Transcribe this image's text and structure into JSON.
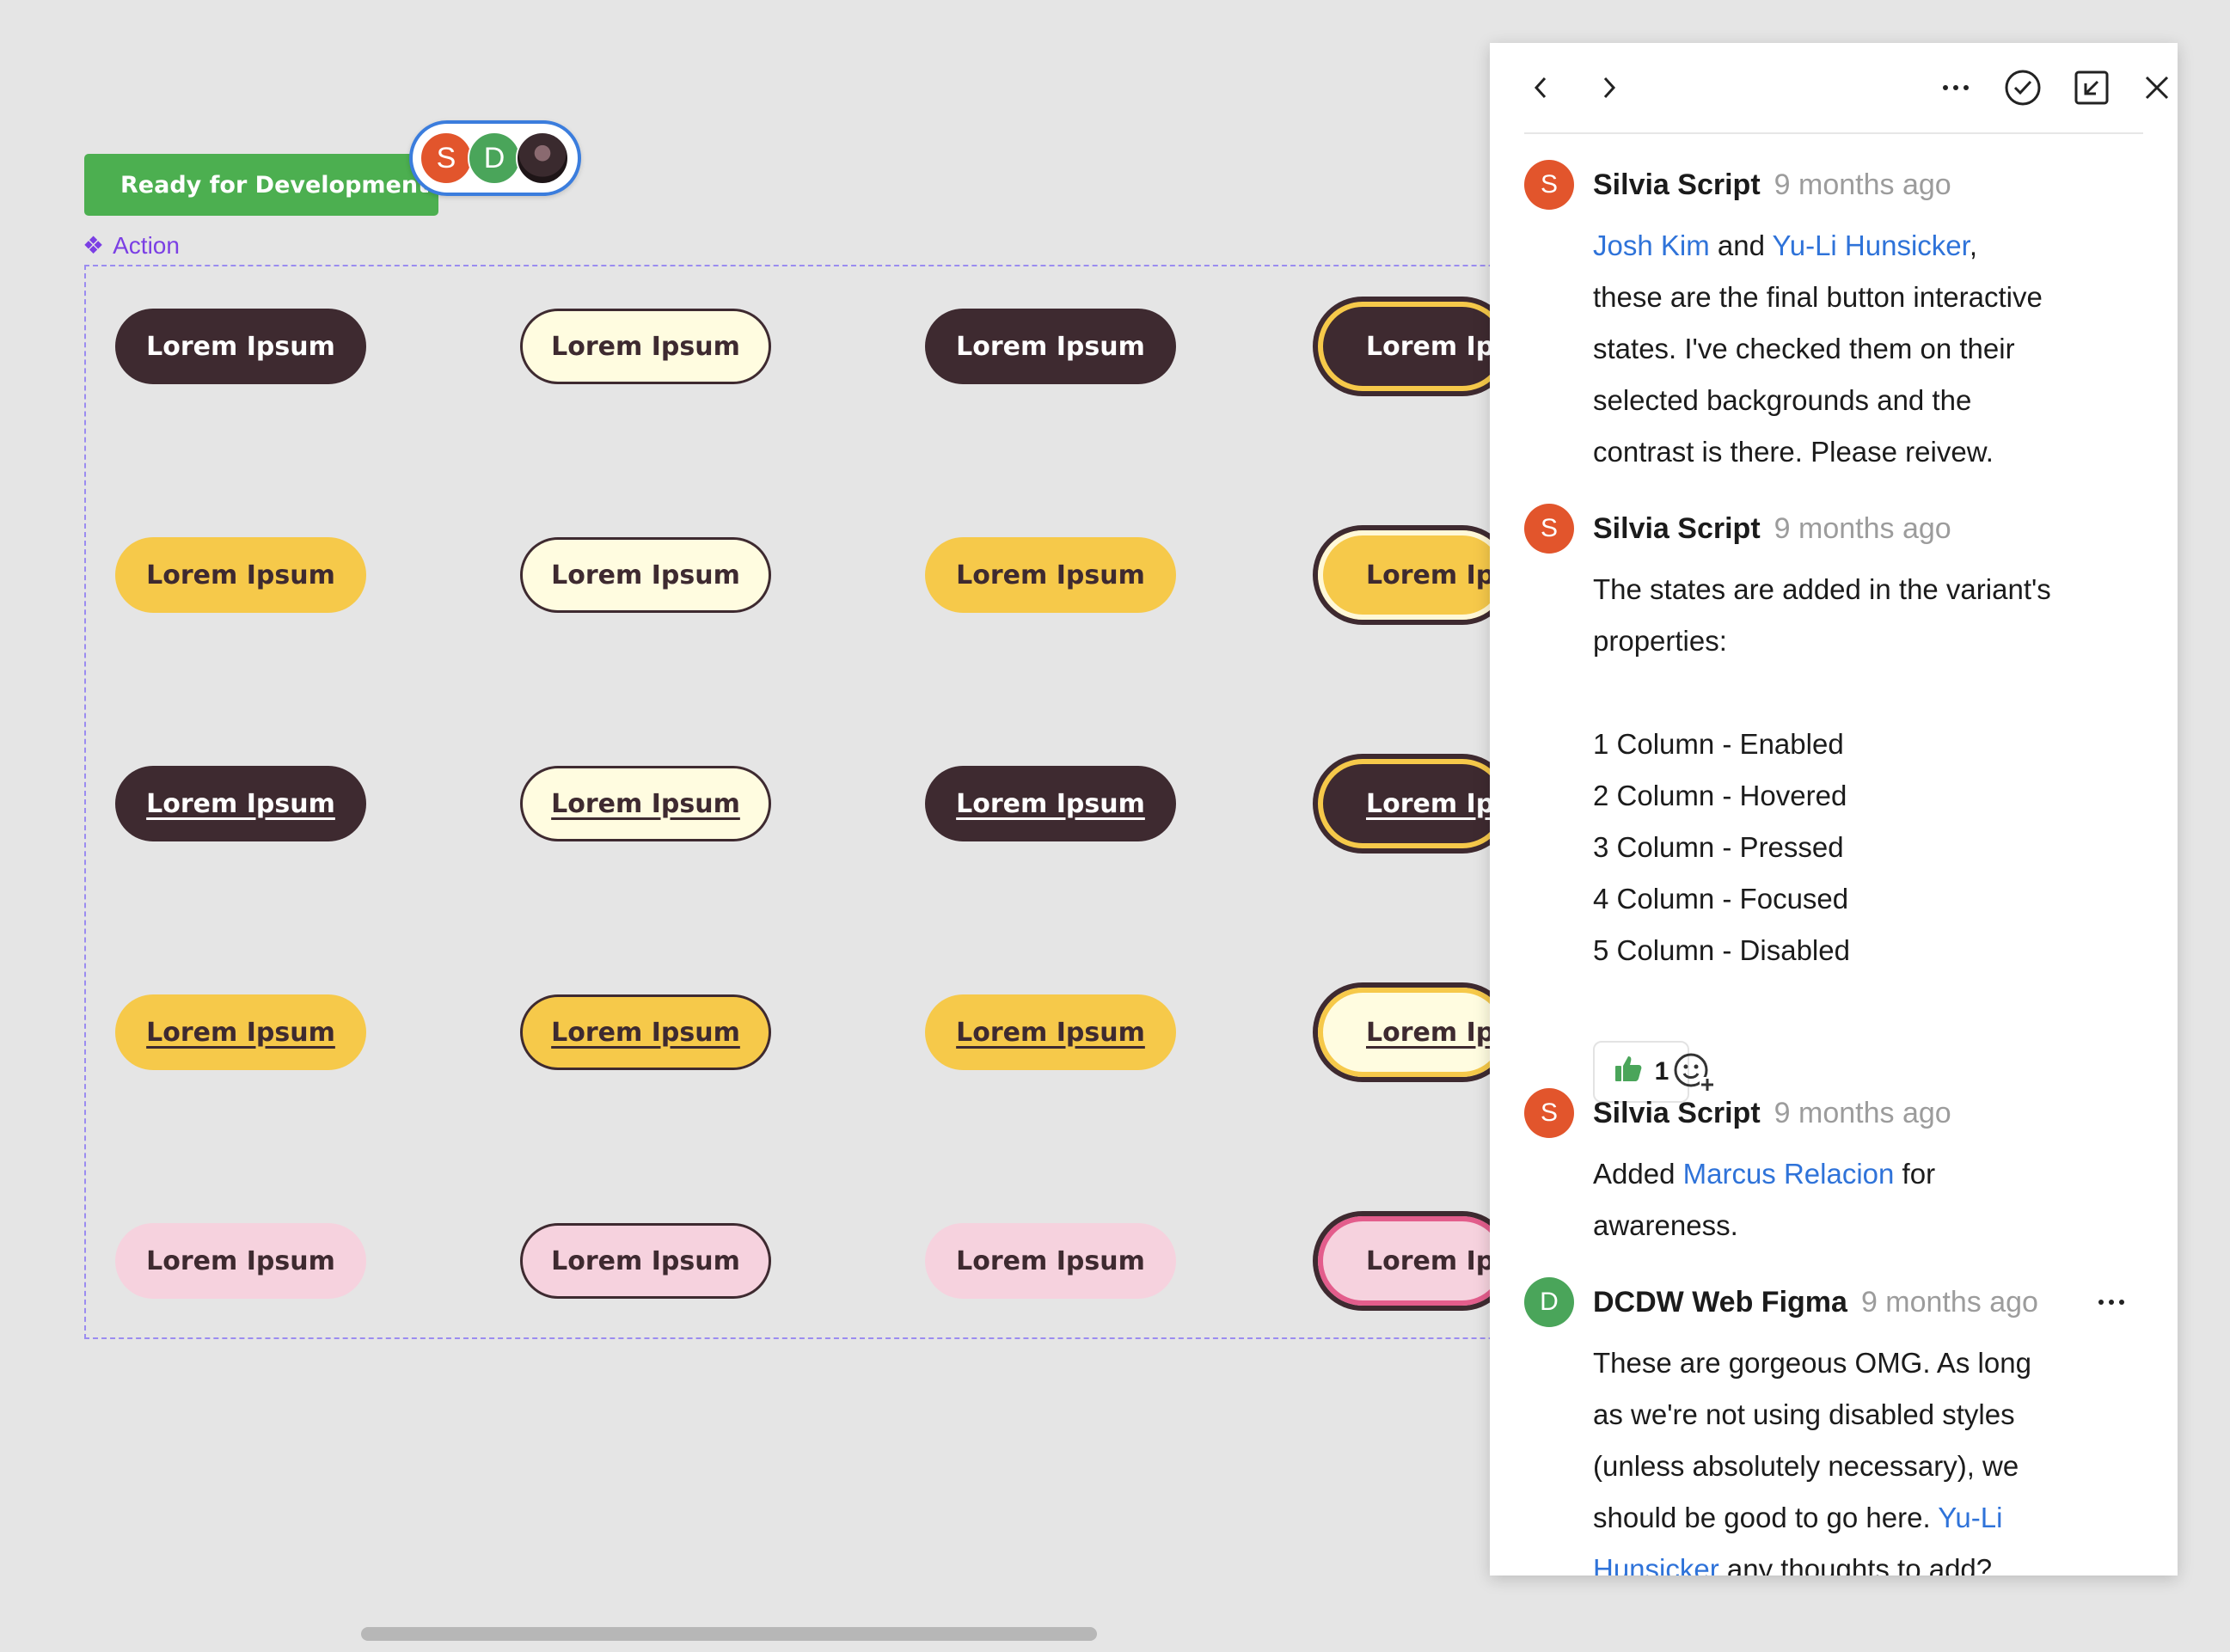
{
  "canvas": {
    "status_tag": "Ready for Development",
    "collaborators": [
      {
        "initial": "S",
        "color": "#e2552c"
      },
      {
        "initial": "D",
        "color": "#4aa55a"
      },
      {
        "initial": "",
        "color": "photo"
      }
    ],
    "component_label": "Action",
    "button_label": "Lorem Ipsum",
    "colors": {
      "dark": "#3e2a30",
      "yellow": "#f6c94a",
      "cream": "#fffce0",
      "pink": "#f6d2de",
      "focus_ring_yellow": "#f6c94a",
      "focus_ring_pink": "#e35d8c",
      "frame_dash": "#9b8cf0",
      "tag_green": "#4caf50"
    },
    "grid_rows": [
      [
        "dark",
        "cream",
        "dark",
        "dark-focus"
      ],
      [
        "yellow",
        "cream",
        "yellow",
        "yellow-focus"
      ],
      [
        "dark-u",
        "cream-u",
        "dark-u",
        "dark-focus-u"
      ],
      [
        "yellow-u",
        "yellow-bordered-u",
        "yellow-u",
        "cream-focus-u"
      ],
      [
        "pink",
        "pink-bordered",
        "pink",
        "pink-focus"
      ]
    ],
    "focused_truncated_label": "Lorem Ips"
  },
  "panel": {
    "toolbar_icons": [
      "chevron-left-icon",
      "chevron-right-icon",
      "more-icon",
      "resolve-check-icon",
      "collapse-icon",
      "close-icon"
    ],
    "comments": [
      {
        "initial": "S",
        "avatar_color": "#e2552c",
        "author": "Silvia Script",
        "time": "9 months ago",
        "body": [
          {
            "mentions": [
              "Josh Kim",
              "Yu-Li Hunsicker"
            ],
            "joiner": "and",
            "trail": ","
          },
          "these are the final button interactive",
          "states. I've checked them on their",
          "selected backgrounds and the",
          "contrast is there. Please reivew."
        ]
      },
      {
        "initial": "S",
        "avatar_color": "#e2552c",
        "author": "Silvia Script",
        "time": "9 months ago",
        "body": [
          "The states are added in the variant's",
          "properties:",
          "",
          "1 Column - Enabled",
          "2 Column - Hovered",
          "3 Column - Pressed",
          "4 Column - Focused",
          "5 Column - Disabled"
        ],
        "reaction": {
          "emoji": "thumbs-up-icon",
          "count": "1"
        }
      },
      {
        "initial": "S",
        "avatar_color": "#e2552c",
        "author": "Silvia Script",
        "time": "9 months ago",
        "body_prefix": "Added",
        "mention": "Marcus Relacion",
        "body_suffix": "for",
        "body_line2": "awareness."
      },
      {
        "initial": "D",
        "avatar_color": "#4aa55a",
        "author": "DCDW Web Figma",
        "time": "9 months ago",
        "body": [
          "These are gorgeous OMG. As long",
          "as we're not using disabled styles",
          "(unless absolutely necessary), we",
          "should be good to go here."
        ],
        "mention_a": "Yu-Li",
        "mention_b": "Hunsicker",
        "tail": "any thoughts to add?"
      }
    ]
  }
}
